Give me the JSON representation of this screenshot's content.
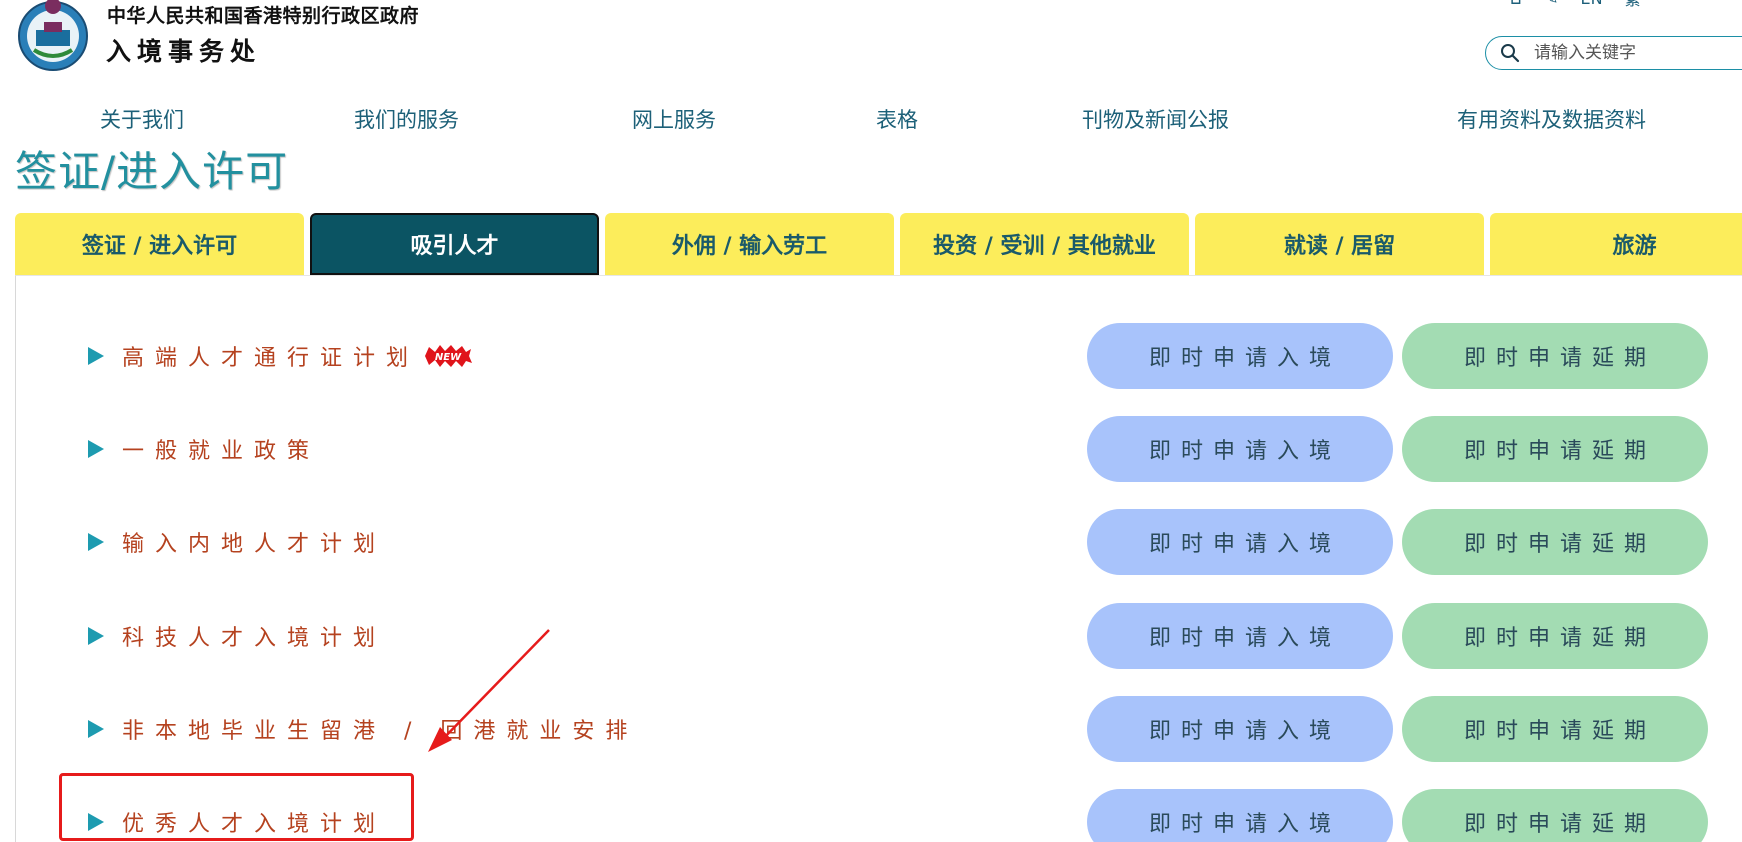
{
  "header": {
    "gov_name": "中华人民共和国香港特别行政区政府",
    "dept_name": "入境事务处",
    "lang_en": "EN",
    "lang_trad": "繁",
    "search_placeholder": "请输入关键字"
  },
  "nav": [
    "关于我们",
    "我们的服务",
    "网上服务",
    "表格",
    "刊物及新闻公报",
    "有用资料及数据资料"
  ],
  "page_title": "签证/进入许可",
  "tabs": [
    "签证 / 进入许可",
    "吸引人才",
    "外佣 / 输入劳工",
    "投资 / 受训 / 其他就业",
    "就读 / 居留",
    "旅游"
  ],
  "items": [
    {
      "label": "高端人才通行证计划",
      "badge": "NEW"
    },
    {
      "label": "一般就业政策"
    },
    {
      "label": "输入内地人才计划"
    },
    {
      "label": "科技人才入境计划"
    },
    {
      "label": "非本地毕业生留港 / 回港就业安排"
    },
    {
      "label": "优秀人才入境计划"
    }
  ],
  "buttons": {
    "entry": "即时申请入境",
    "extend": "即时申请延期"
  },
  "colors": {
    "tab_bg": "#fced5b",
    "tab_active_bg": "#0b5463",
    "item_text": "#b5421f",
    "entry_btn": "#a8c3fb",
    "extend_btn": "#a3dcb3",
    "annotation": "#e61b1b"
  }
}
